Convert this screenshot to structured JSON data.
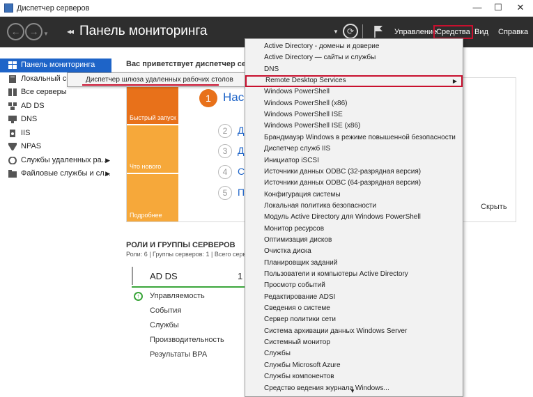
{
  "window": {
    "title": "Диспетчер серверов",
    "min": "—",
    "max": "☐",
    "close": "✕"
  },
  "header": {
    "title": "Панель мониторинга",
    "menu": [
      "Управление",
      "Средства",
      "Вид",
      "Справка"
    ],
    "accent": "#c8102e"
  },
  "sidebar": {
    "items": [
      {
        "label": "Панель мониторинга",
        "icon": "dashboard-icon"
      },
      {
        "label": "Локальный се",
        "icon": "server-icon"
      },
      {
        "label": "Все серверы",
        "icon": "servers-icon"
      },
      {
        "label": "AD DS",
        "icon": "ad-icon"
      },
      {
        "label": "DNS",
        "icon": "dns-icon"
      },
      {
        "label": "IIS",
        "icon": "iis-icon"
      },
      {
        "label": "NPAS",
        "icon": "npas-icon"
      },
      {
        "label": "Службы удаленных ра...",
        "icon": "rds-icon"
      },
      {
        "label": "Файловые службы и сл...",
        "icon": "file-services-icon"
      }
    ]
  },
  "tooltip": {
    "label": "Диспетчер шлюза удаленных рабочих столов"
  },
  "main": {
    "welcome": "Вас приветствует диспетчер серве",
    "quickstart": {
      "tiles": [
        "Быстрый запуск",
        "Что нового",
        "Подробнее"
      ],
      "step1_num": "1",
      "step1_text": "Нас",
      "steps": [
        {
          "num": "2",
          "text": "Д"
        },
        {
          "num": "3",
          "text": "Д"
        },
        {
          "num": "4",
          "text": "С"
        },
        {
          "num": "5",
          "text": "П"
        }
      ],
      "hide": "Скрыть"
    },
    "roles": {
      "title": "РОЛИ И ГРУППЫ СЕРВЕРОВ",
      "subtitle": "Роли: 6 | Группы серверов: 1 | Всего серве",
      "card": {
        "name": "AD DS",
        "count": "1",
        "rows": [
          "Управляемость",
          "События",
          "Службы",
          "Производительность",
          "Результаты BPA"
        ]
      }
    }
  },
  "dropdown": {
    "items": [
      "Active Directory - домены и доверие",
      "Active Directory — сайты и службы",
      "DNS",
      "Remote Desktop Services",
      "Windows PowerShell",
      "Windows PowerShell (x86)",
      "Windows PowerShell ISE",
      "Windows PowerShell ISE (x86)",
      "Брандмауэр Windows в режиме повышенной безопасности",
      "Диспетчер служб IIS",
      "Инициатор iSCSI",
      "Источники данных ODBC (32-разрядная версия)",
      "Источники данных ODBC (64-разрядная версия)",
      "Конфигурация системы",
      "Локальная политика безопасности",
      "Модуль Active Directory для Windows PowerShell",
      "Монитор ресурсов",
      "Оптимизация дисков",
      "Очистка диска",
      "Планировщик заданий",
      "Пользователи и компьютеры Active Directory",
      "Просмотр событий",
      "Редактирование ADSI",
      "Сведения о системе",
      "Сервер политики сети",
      "Система архивации данных Windows Server",
      "Системный монитор",
      "Службы",
      "Службы Microsoft Azure",
      "Службы компонентов",
      "Средство ведения журнала Windows..."
    ],
    "highlighted_index": 3
  }
}
